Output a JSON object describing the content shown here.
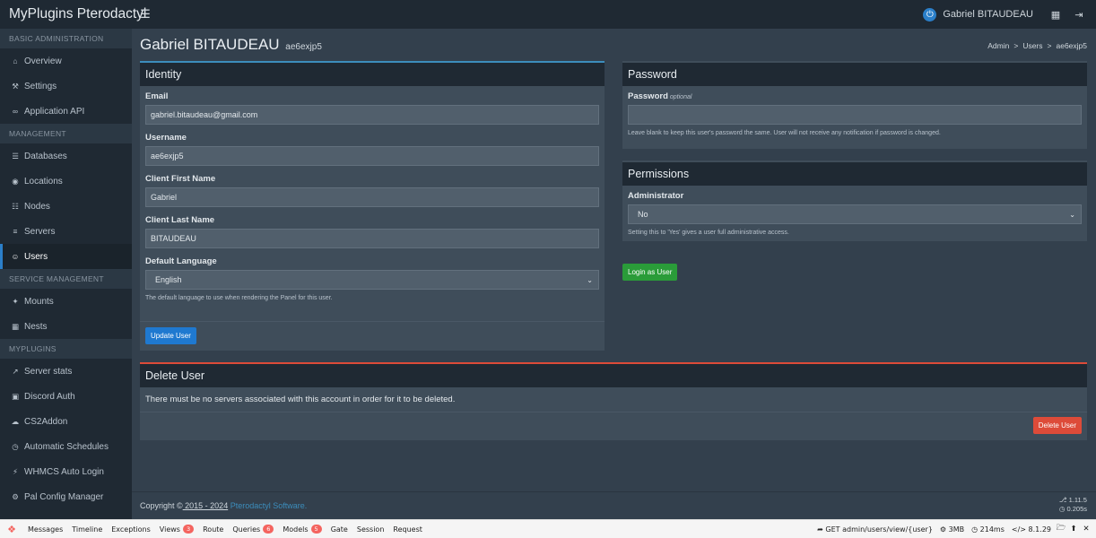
{
  "app": {
    "brand": "MyPlugins Pterodactyl",
    "user_name": "Gabriel BITAUDEAU"
  },
  "icons": {
    "menu": "hamburger-icon",
    "power": "power-icon",
    "switch_view": "grid-icon",
    "logout": "logout-icon"
  },
  "sidebar": {
    "sections": [
      {
        "header": "BASIC ADMINISTRATION",
        "items": [
          {
            "label": "Overview",
            "icon": "home-icon"
          },
          {
            "label": "Settings",
            "icon": "wrench-icon"
          },
          {
            "label": "Application API",
            "icon": "link-icon"
          }
        ]
      },
      {
        "header": "MANAGEMENT",
        "items": [
          {
            "label": "Databases",
            "icon": "database-icon"
          },
          {
            "label": "Locations",
            "icon": "globe-icon"
          },
          {
            "label": "Nodes",
            "icon": "sitemap-icon"
          },
          {
            "label": "Servers",
            "icon": "server-icon"
          },
          {
            "label": "Users",
            "icon": "users-icon",
            "active": true
          }
        ]
      },
      {
        "header": "SERVICE MANAGEMENT",
        "items": [
          {
            "label": "Mounts",
            "icon": "magic-icon"
          },
          {
            "label": "Nests",
            "icon": "th-large-icon"
          }
        ]
      },
      {
        "header": "MYPLUGINS",
        "items": [
          {
            "label": "Server stats",
            "icon": "chart-line-icon"
          },
          {
            "label": "Discord Auth",
            "icon": "discord-icon"
          },
          {
            "label": "CS2Addon",
            "icon": "cloud-icon"
          },
          {
            "label": "Automatic Schedules",
            "icon": "clock-icon"
          },
          {
            "label": "WHMCS Auto Login",
            "icon": "bolt-icon"
          },
          {
            "label": "Pal Config Manager",
            "icon": "cogs-icon"
          }
        ]
      }
    ]
  },
  "page": {
    "title": "Gabriel BITAUDEAU",
    "subtitle": "ae6exjp5",
    "breadcrumb": [
      "Admin",
      "Users",
      "ae6exjp5"
    ],
    "breadcrumb_sep": ">"
  },
  "identity": {
    "title": "Identity",
    "email_label": "Email",
    "email_value": "gabriel.bitaudeau@gmail.com",
    "username_label": "Username",
    "username_value": "ae6exjp5",
    "first_name_label": "Client First Name",
    "first_name_value": "Gabriel",
    "last_name_label": "Client Last Name",
    "last_name_value": "BITAUDEAU",
    "language_label": "Default Language",
    "language_value": "English",
    "language_help": "The default language to use when rendering the Panel for this user.",
    "update_button": "Update User"
  },
  "password": {
    "title": "Password",
    "label": "Password",
    "optional": "optional",
    "value": "",
    "help": "Leave blank to keep this user's password the same. User will not receive any notification if password is changed."
  },
  "permissions": {
    "title": "Permissions",
    "admin_label": "Administrator",
    "admin_value": "No",
    "help": "Setting this to 'Yes' gives a user full administrative access."
  },
  "login_as_button": "Login as User",
  "delete": {
    "title": "Delete User",
    "text": "There must be no servers associated with this account in order for it to be deleted.",
    "button": "Delete User"
  },
  "footer": {
    "copyright_prefix": "Copyright ©",
    "years": " 2015 - 2024",
    "link_text": " Pterodactyl Software.",
    "version": "1.11.5",
    "time": "0.205s"
  },
  "debugbar": {
    "tabs": [
      {
        "label": "Messages"
      },
      {
        "label": "Timeline"
      },
      {
        "label": "Exceptions"
      },
      {
        "label": "Views",
        "badge": "3"
      },
      {
        "label": "Route"
      },
      {
        "label": "Queries",
        "badge": "6"
      },
      {
        "label": "Models",
        "badge": "5"
      },
      {
        "label": "Gate"
      },
      {
        "label": "Session"
      },
      {
        "label": "Request"
      }
    ],
    "route": "GET admin/users/view/{user}",
    "memory": "3MB",
    "duration": "214ms",
    "php_version": "8.1.29"
  }
}
